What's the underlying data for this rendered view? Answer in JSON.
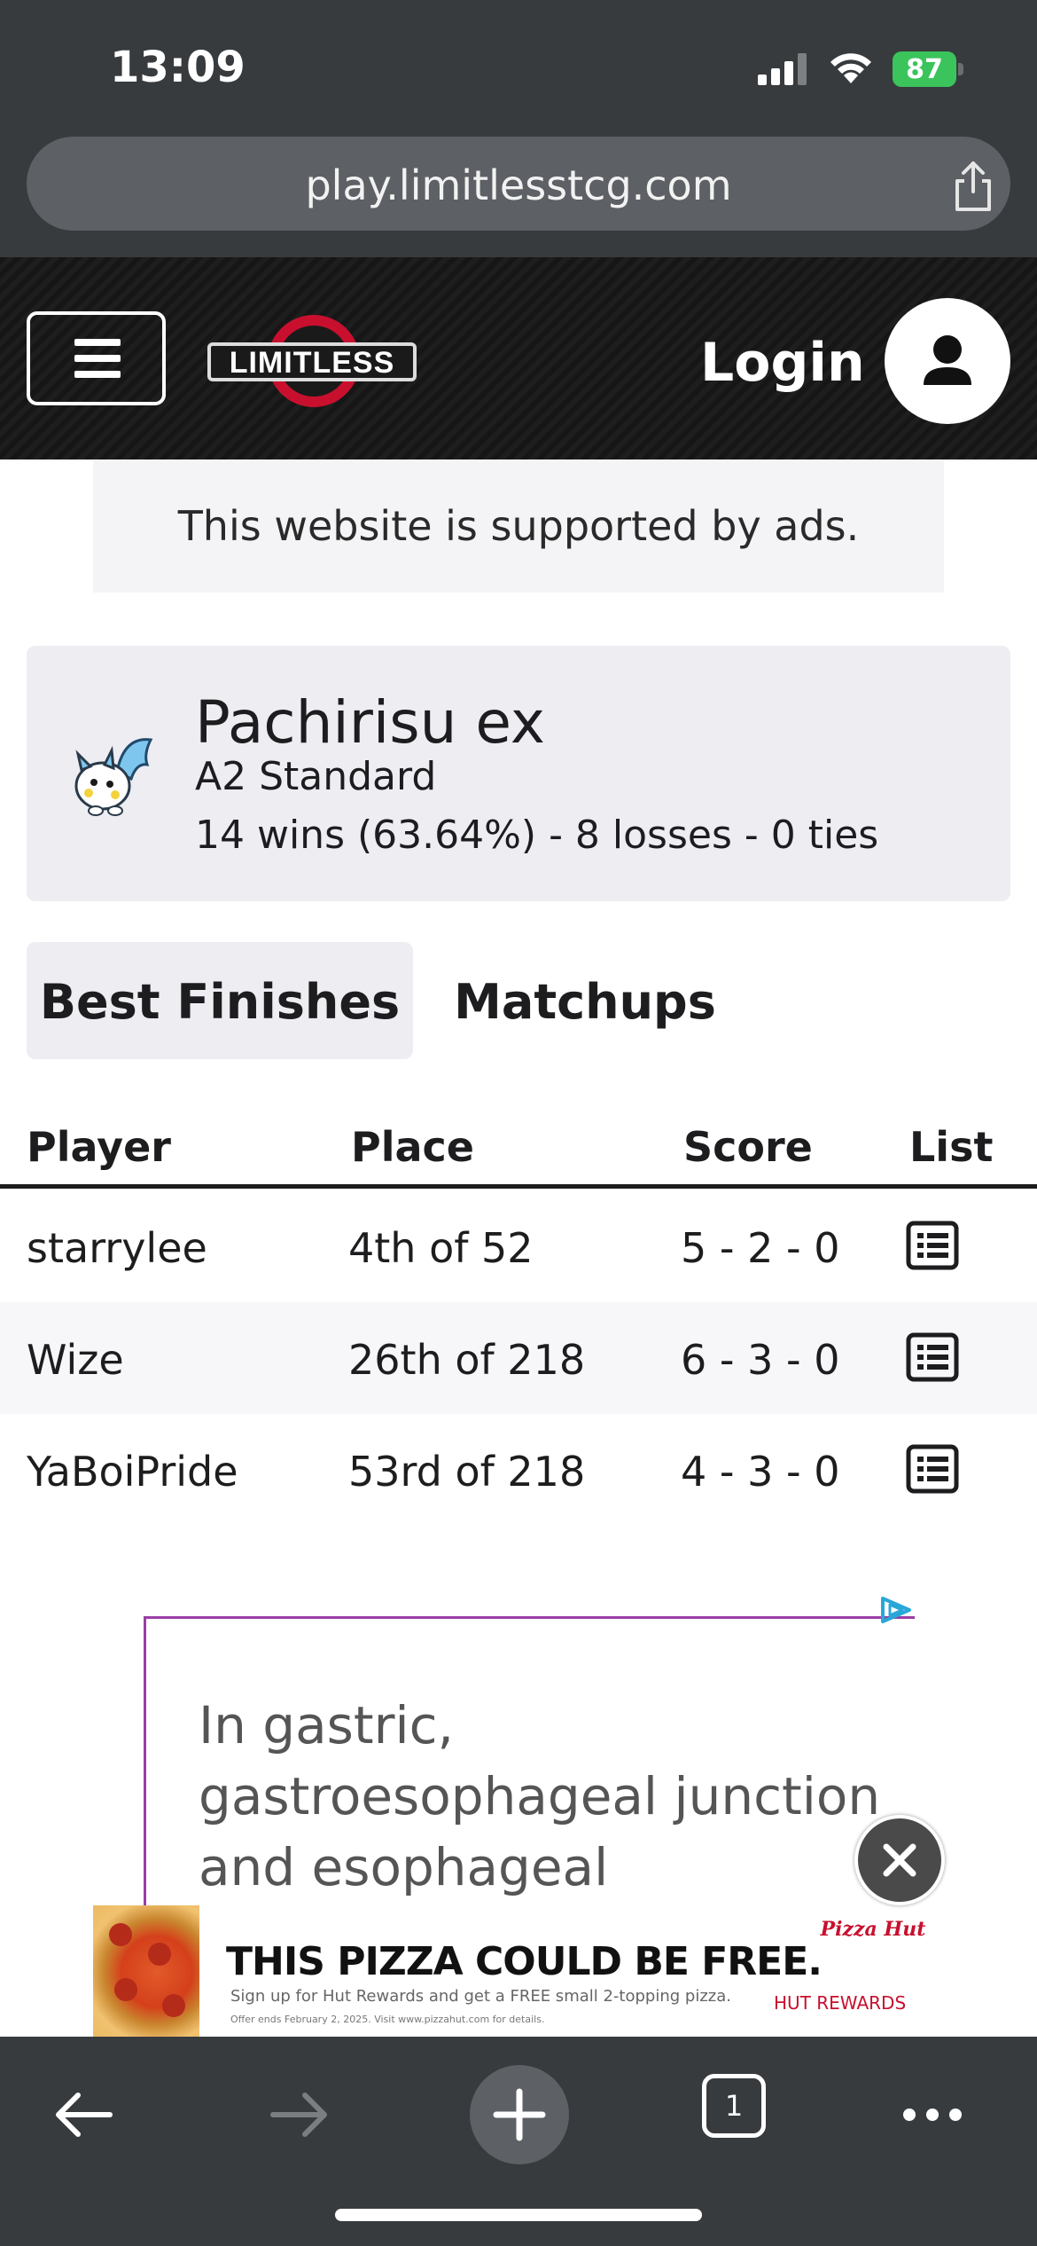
{
  "status_bar": {
    "time": "13:09",
    "battery": "87"
  },
  "browser": {
    "url": "play.limitlesstcg.com"
  },
  "header": {
    "login_label": "Login"
  },
  "ad_notice": "This website is supported by ads.",
  "deck": {
    "name": "Pachirisu ex",
    "format": "A2 Standard",
    "record": "14 wins (63.64%) - 8 losses - 0 ties"
  },
  "tabs": [
    {
      "label": "Best Finishes",
      "active": true
    },
    {
      "label": "Matchups",
      "active": false
    }
  ],
  "table": {
    "headers": {
      "player": "Player",
      "place": "Place",
      "score": "Score",
      "list": "List"
    },
    "rows": [
      {
        "player": "starrylee",
        "place": "4th of 52",
        "score": "5 - 2 - 0"
      },
      {
        "player": "Wize",
        "place": "26th of 218",
        "score": "6 - 3 - 0"
      },
      {
        "player": "YaBoiPride",
        "place": "53rd of 218",
        "score": "4 - 3 - 0"
      }
    ]
  },
  "ad": {
    "copy": "In gastric, gastroesophageal junction and esophageal adenocarcinomas,",
    "banner_headline": "THIS PIZZA COULD BE FREE.",
    "banner_sub": "Sign up for Hut Rewards and get a FREE small 2-topping pizza.",
    "banner_fine": "Offer ends February 2, 2025. Visit www.pizzahut.com for details.",
    "banner_logo": "Pizza Hut",
    "banner_rewards": "HUT REWARDS"
  },
  "toolbar": {
    "tab_count": "1"
  },
  "colors": {
    "chrome": "#383b3e",
    "header_bg": "#161616",
    "card_bg": "#ededf2",
    "battery": "#3bc45c",
    "ad_border": "#9b3ea6"
  }
}
